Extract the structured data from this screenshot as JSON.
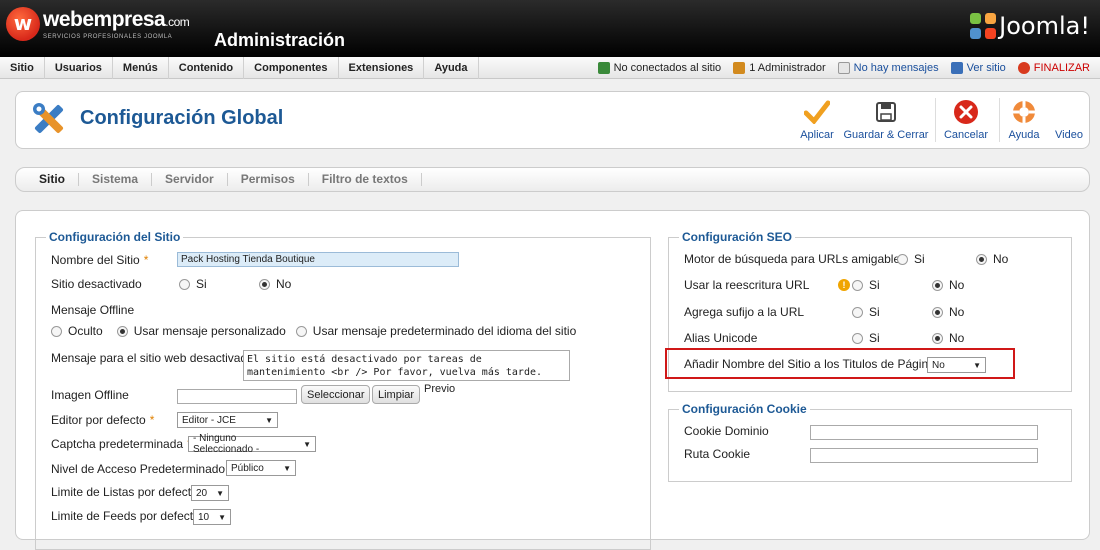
{
  "brand": {
    "logo_letter": "w",
    "name": "webempresa",
    "domain": ".com",
    "tagline": "SERVICIOS PROFESIONALES JOOMLA",
    "admin_title": "Administración",
    "joomla_text": "Joomla!",
    "colors": {
      "accent_blue": "#1d5995",
      "header_bg": "#111111",
      "highlight_red": "#d01818"
    }
  },
  "menu": [
    "Sitio",
    "Usuarios",
    "Menús",
    "Contenido",
    "Componentes",
    "Extensiones",
    "Ayuda"
  ],
  "status": {
    "connected": "No conectados al sitio",
    "admins": "1 Administrador",
    "messages": "No hay mensajes",
    "view_site": "Ver sitio",
    "logout": "FINALIZAR"
  },
  "toolbar": {
    "title": "Configuración Global",
    "apply": "Aplicar",
    "save_close": "Guardar & Cerrar",
    "cancel": "Cancelar",
    "help": "Ayuda",
    "video": "Video"
  },
  "tabs": [
    "Sitio",
    "Sistema",
    "Servidor",
    "Permisos",
    "Filtro de textos"
  ],
  "site": {
    "legend": "Configuración del Sitio",
    "name_label": "Nombre del Sitio",
    "name_value": "Pack Hosting Tienda Boutique",
    "offline_label": "Sitio desactivado",
    "yes": "Si",
    "no": "No",
    "offline_msg_label": "Mensaje Offline",
    "opt_hidden": "Oculto",
    "opt_custom": "Usar mensaje personalizado",
    "opt_default": "Usar mensaje predeterminado del idioma del sitio",
    "deactivated_msg_label": "Mensaje para el sitio web desactivado",
    "deactivated_msg_value": "El sitio está desactivado por tareas de mantenimiento <br /> Por favor, vuelva más tarde.",
    "offline_image_label": "Imagen Offline",
    "select_btn": "Seleccionar",
    "clear_btn": "Limpiar",
    "preview": "Previo",
    "editor_label": "Editor por defecto",
    "editor_value": "Editor - JCE",
    "captcha_label": "Captcha predeterminada",
    "captcha_value": "- Ninguno Seleccionado -",
    "access_label": "Nivel de Acceso Predeterminado",
    "access_value": "Público",
    "list_limit_label": "Limite de Listas por defecto",
    "list_limit_value": "20",
    "feed_limit_label": "Limite de Feeds por defecto",
    "feed_limit_value": "10"
  },
  "seo": {
    "legend": "Configuración SEO",
    "sef_label": "Motor de búsqueda para URLs amigables",
    "rewrite_label": "Usar la reescritura URL",
    "suffix_label": "Agrega sufijo a la URL",
    "unicode_label": "Alias Unicode",
    "sitename_label": "Añadir Nombre del Sitio a los Titulos de Páginas",
    "sitename_value": "No",
    "yes": "Si",
    "no": "No"
  },
  "cookie": {
    "legend": "Configuración Cookie",
    "domain_label": "Cookie Dominio",
    "path_label": "Ruta Cookie"
  }
}
